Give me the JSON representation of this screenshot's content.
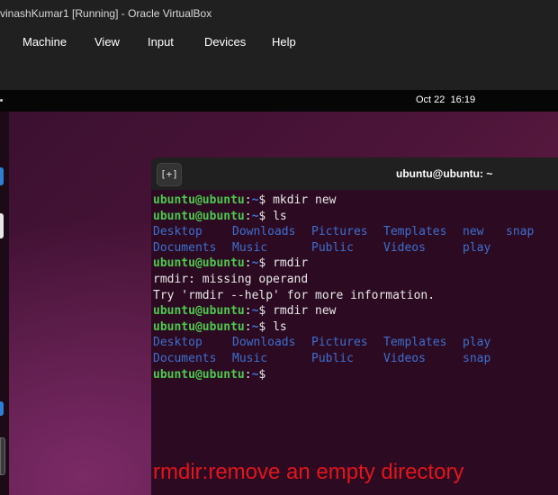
{
  "window": {
    "title": "vinashKumar1 [Running] - Oracle VirtualBox"
  },
  "menubar": {
    "items": [
      "Machine",
      "View",
      "Input",
      "Devices",
      "Help"
    ]
  },
  "topbar": {
    "date": "Oct 22",
    "time": "16:19"
  },
  "terminal": {
    "tab_button_label": "[+]",
    "title": "ubuntu@ubuntu: ~",
    "prompt_user": "ubuntu@ubuntu",
    "prompt_sep": ":",
    "prompt_path": "~",
    "prompt_symbol": "$",
    "cmd1": "mkdir new",
    "cmd2": "ls",
    "ls1_row1": [
      "Desktop",
      "Downloads",
      "Pictures",
      "Templates",
      "new",
      "snap"
    ],
    "ls1_row2": [
      "Documents",
      "Music",
      "Public",
      "Videos",
      "play"
    ],
    "cmd3": "rmdir",
    "out3_line1": "rmdir: missing operand",
    "out3_line2": "Try 'rmdir --help' for more information.",
    "cmd4": "rmdir new",
    "cmd5": "ls",
    "ls2_row1": [
      "Desktop",
      "Downloads",
      "Pictures",
      "Templates",
      "play"
    ],
    "ls2_row2": [
      "Documents",
      "Music",
      "Public",
      "Videos",
      "snap"
    ]
  },
  "caption": "rmdir:remove an empty directory",
  "colors": {
    "prompt_user": "#4ec94e",
    "prompt_path": "#3b78d8",
    "directory": "#3d6fce",
    "caption": "#e3141c",
    "terminal_bg": "#2c0a22"
  }
}
